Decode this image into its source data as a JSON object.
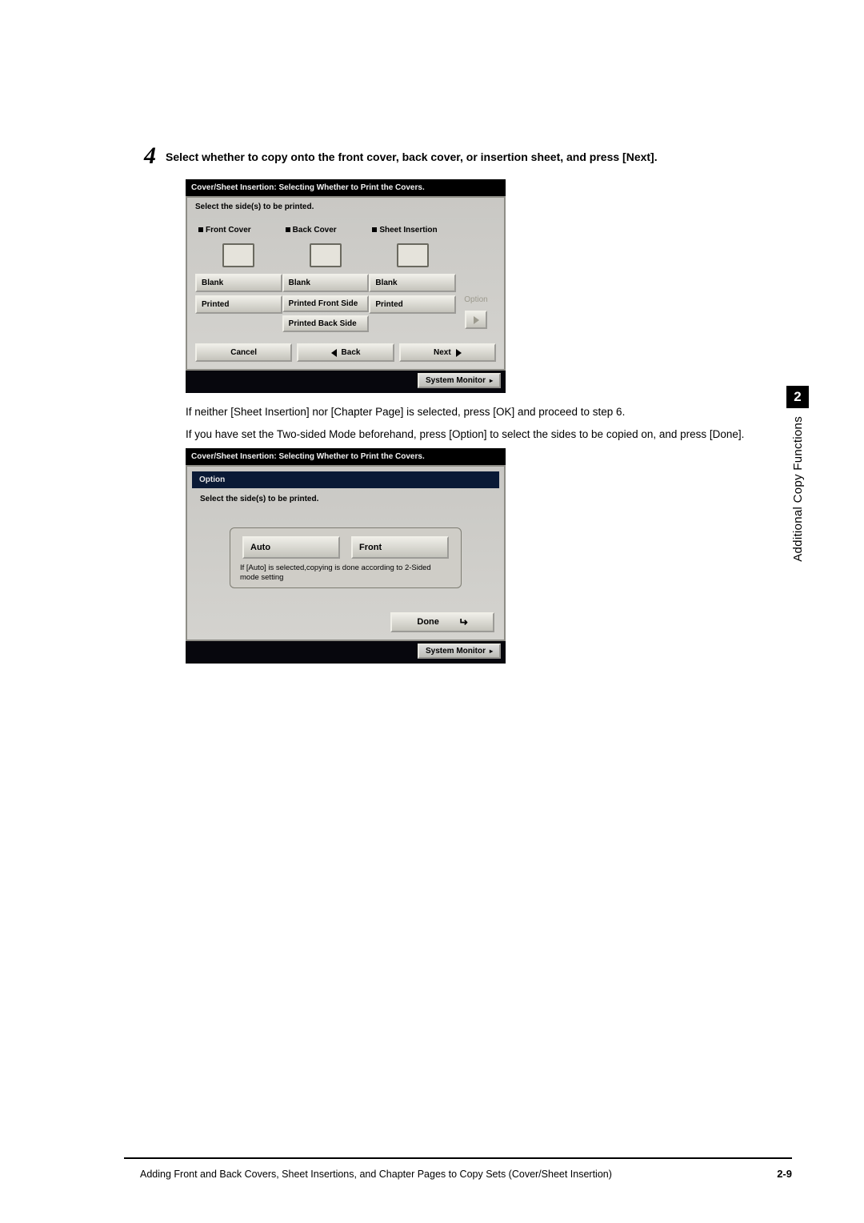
{
  "step": {
    "number": "4",
    "instruction": "Select whether to copy onto the front cover, back cover, or insertion sheet, and press [Next]."
  },
  "screenshot1": {
    "titlebar": "Cover/Sheet Insertion: Selecting Whether to Print the Covers.",
    "instruction": "Select the side(s) to be printed.",
    "col_front": {
      "header": "Front Cover",
      "btn_blank": "Blank",
      "btn_printed": "Printed"
    },
    "col_back": {
      "header": "Back Cover",
      "btn_blank": "Blank",
      "btn_printed_front": "Printed Front Side",
      "btn_printed_back": "Printed Back Side"
    },
    "col_sheet": {
      "header": "Sheet Insertion",
      "btn_blank": "Blank",
      "btn_printed": "Printed"
    },
    "option_label": "Option",
    "footer": {
      "cancel": "Cancel",
      "back": "Back",
      "next": "Next"
    },
    "system_monitor": "System Monitor"
  },
  "paragraph1": "If neither [Sheet Insertion] nor [Chapter Page] is selected, press [OK] and proceed to step 6.",
  "paragraph2": "If you have set the Two-sided Mode beforehand, press [Option] to select the sides to be copied on, and press [Done].",
  "screenshot2": {
    "titlebar": "Cover/Sheet Insertion: Selecting Whether to Print the Covers.",
    "option_title": "Option",
    "instruction": "Select the side(s) to be printed.",
    "btn_auto": "Auto",
    "btn_front": "Front",
    "hint": "If [Auto] is selected,copying is done according to 2-Sided mode setting",
    "done": "Done",
    "system_monitor": "System Monitor"
  },
  "sidetab": {
    "chapter": "2",
    "label": "Additional Copy Functions"
  },
  "footer_text": "Adding Front and Back Covers, Sheet Insertions, and Chapter Pages to Copy Sets (Cover/Sheet Insertion)",
  "page_number": "2-9"
}
